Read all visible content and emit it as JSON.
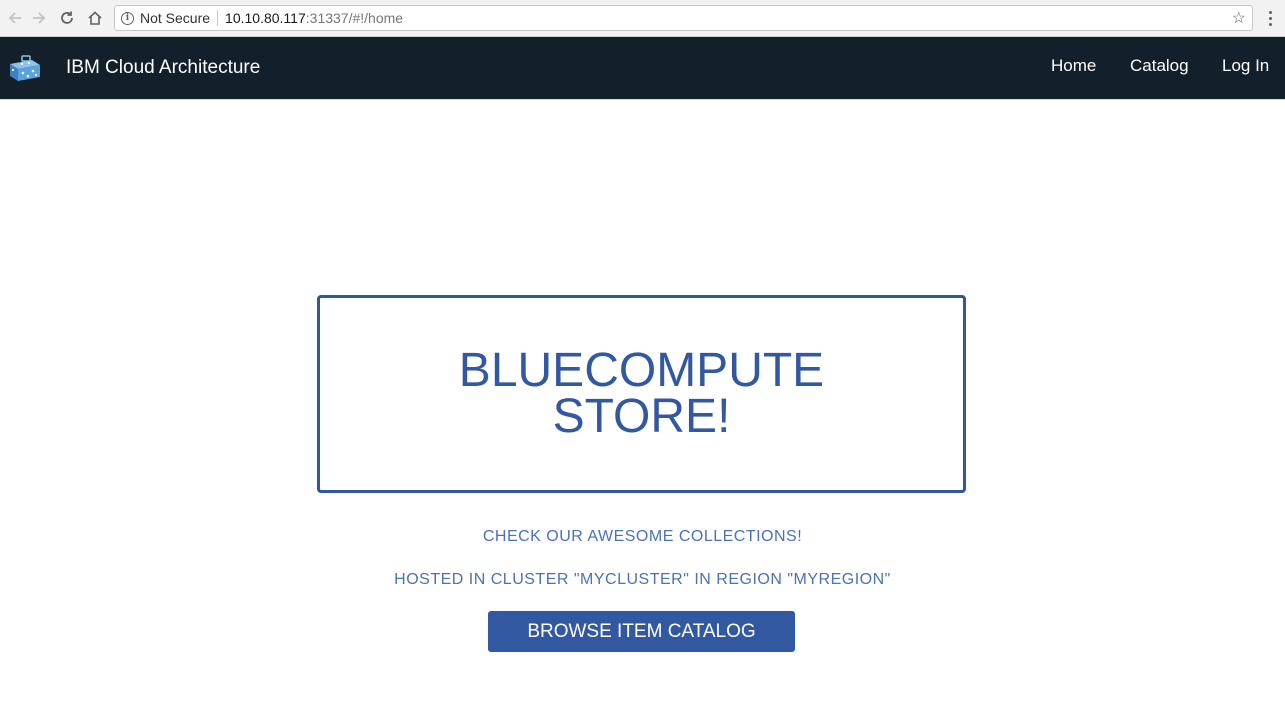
{
  "browser": {
    "back_icon": "arrow-left",
    "forward_icon": "arrow-right",
    "reload_icon": "reload",
    "home_icon": "home",
    "security_label": "Not Secure",
    "url_host": "10.10.80.117",
    "url_rest": ":31337/#!/home",
    "bookmark_icon": "star",
    "menu_icon": "vertical-dots"
  },
  "nav": {
    "brand": "IBM Cloud Architecture",
    "links": [
      {
        "label": "Home"
      },
      {
        "label": "Catalog"
      },
      {
        "label": "Log In"
      }
    ],
    "background": "#131f2b"
  },
  "hero": {
    "title_line1": "BLUECOMPUTE",
    "title_line2": "STORE!",
    "accent_color": "#3358a2"
  },
  "content": {
    "tagline": "CHECK OUR AWESOME COLLECTIONS!",
    "hosted_info": "HOSTED IN CLUSTER \"MYCLUSTER\" IN REGION \"MYREGION\"",
    "cta_label": "BROWSE ITEM CATALOG"
  }
}
